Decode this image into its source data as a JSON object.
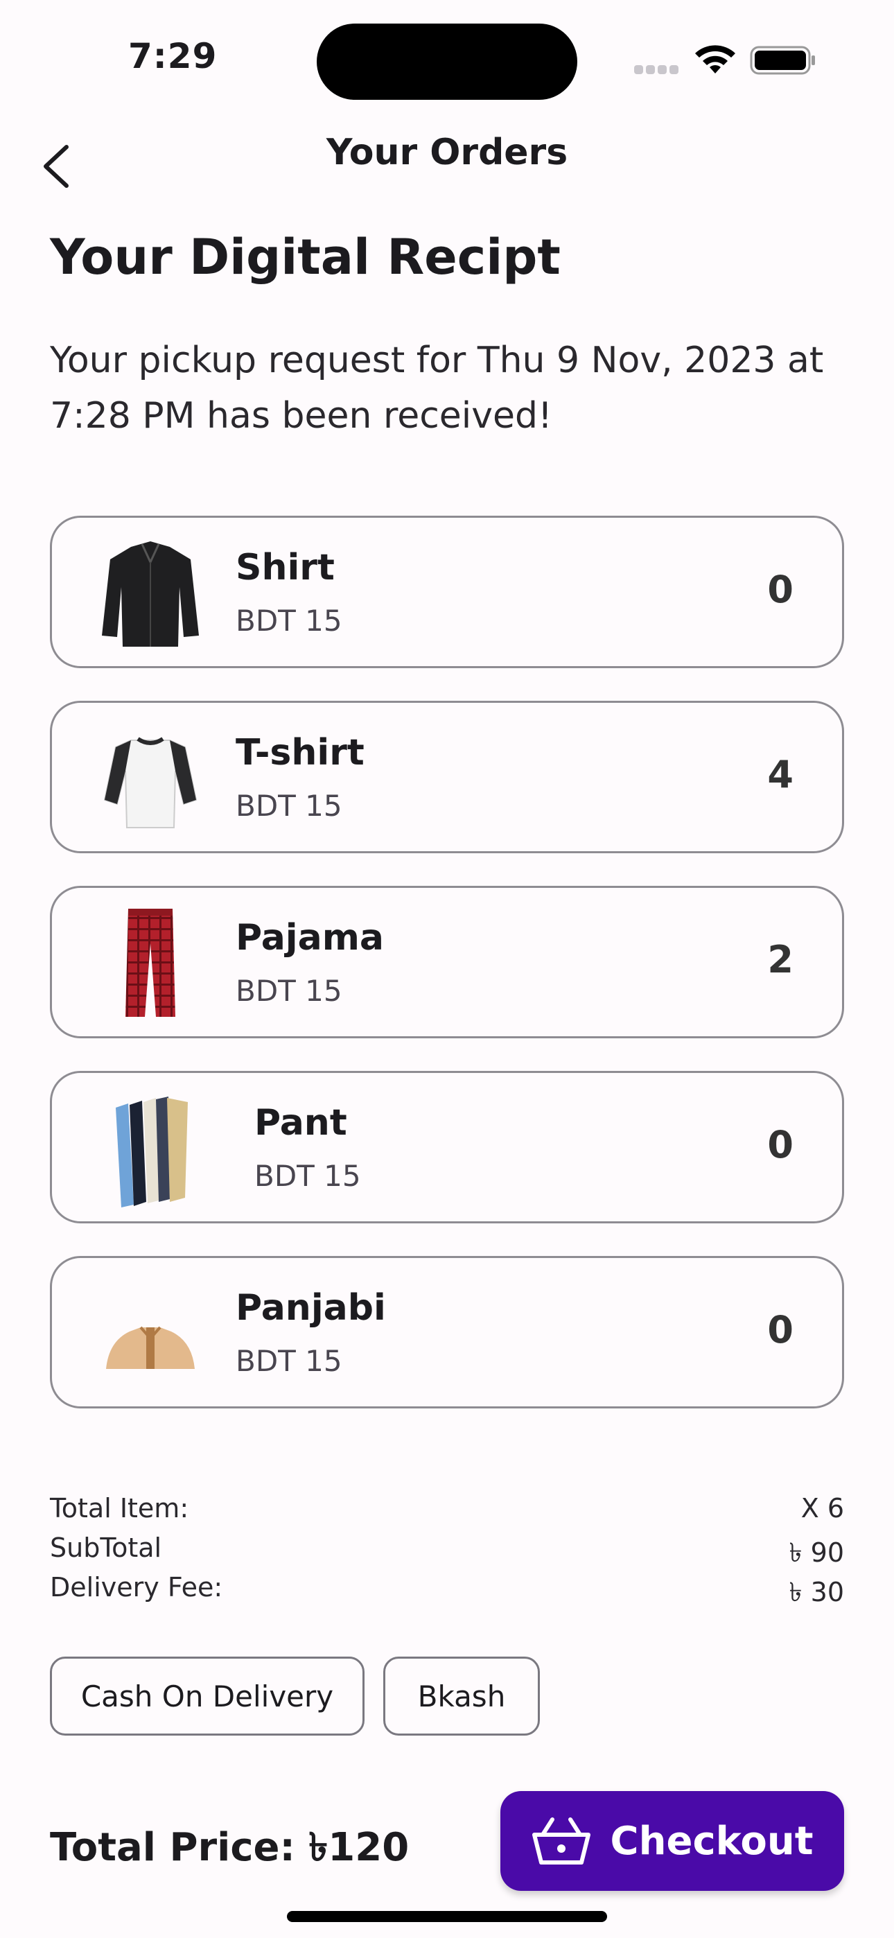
{
  "status_bar": {
    "time": "7:29"
  },
  "header": {
    "title": "Your Orders"
  },
  "receipt": {
    "heading": "Your Digital Recipt",
    "message": "Your pickup request for Thu 9 Nov, 2023 at 7:28 PM has been received!"
  },
  "items": [
    {
      "name": "Shirt",
      "price": "BDT 15",
      "qty": "0",
      "icon": "shirt-icon"
    },
    {
      "name": "T-shirt",
      "price": "BDT 15",
      "qty": "4",
      "icon": "tshirt-icon"
    },
    {
      "name": "Pajama",
      "price": "BDT 15",
      "qty": "2",
      "icon": "pajama-icon"
    },
    {
      "name": "Pant",
      "price": "BDT 15",
      "qty": "0",
      "icon": "pant-icon"
    },
    {
      "name": "Panjabi",
      "price": "BDT 15",
      "qty": "0",
      "icon": "panjabi-icon"
    }
  ],
  "summary": {
    "total_item_label": "Total Item:",
    "total_item_value": "X 6",
    "subtotal_label": "SubTotal",
    "subtotal_value": "৳ 90",
    "delivery_label": "Delivery Fee:",
    "delivery_value": "৳ 30"
  },
  "payment": {
    "cod_label": "Cash On Delivery",
    "bkash_label": "Bkash"
  },
  "footer": {
    "total_label": "Total Price: ৳120",
    "checkout_label": "Checkout"
  },
  "colors": {
    "accent": "#4a0aa8",
    "card_border": "#8e8c92",
    "background": "#fefbfd"
  }
}
